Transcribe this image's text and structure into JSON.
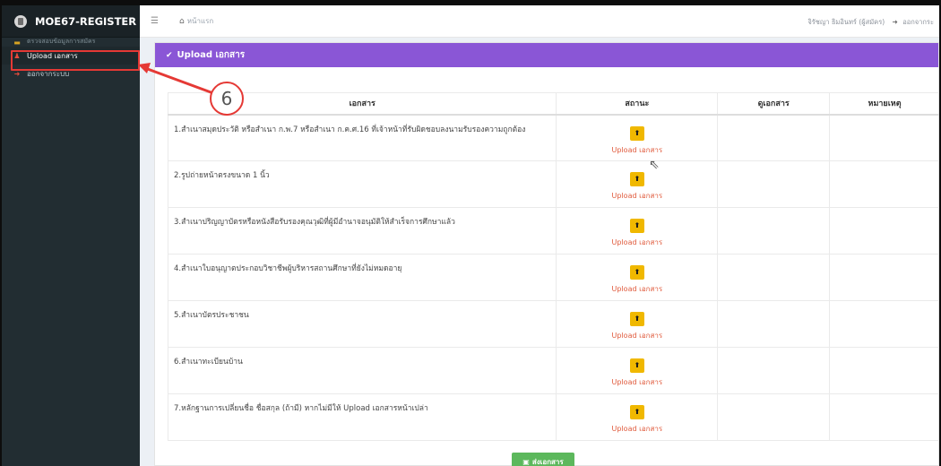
{
  "app": {
    "title": "MOE67-REGISTER"
  },
  "sidebar": {
    "partial_item": "ตรวจสอบข้อมูลการสมัคร",
    "items": [
      {
        "label": "Upload เอกสาร",
        "icon": "upload-user-icon"
      },
      {
        "label": "ออกจากระบบ",
        "icon": "logout-icon"
      }
    ]
  },
  "header": {
    "breadcrumb": "หน้าแรก",
    "user": "จิรัชญา ธิมอินทร์ (ผู้สมัคร)",
    "logout": "ออกจากระ"
  },
  "panel": {
    "title": "Upload เอกสาร"
  },
  "table": {
    "headers": [
      "เอกสาร",
      "สถานะ",
      "ดูเอกสาร",
      "หมายเหตุ"
    ],
    "rows": [
      {
        "doc": "1.สำเนาสมุดประวัติ หรือสำเนา ก.พ.7 หรือสำเนา ก.ค.ศ.16 ที่เจ้าหน้าที่รับผิดชอบลงนามรับรองความถูกต้อง",
        "status": "Upload เอกสาร"
      },
      {
        "doc": "2.รูปถ่ายหน้าตรงขนาด 1 นิ้ว",
        "status": "Upload เอกสาร"
      },
      {
        "doc": "3.สำเนาปริญญาบัตรหรือหนังสือรับรองคุณวุฒิที่ผู้มีอำนาจอนุมัติให้สำเร็จการศึกษาแล้ว",
        "status": "Upload เอกสาร"
      },
      {
        "doc": "4.สำเนาใบอนุญาตประกอบวิชาชีพผู้บริหารสถานศึกษาที่ยังไม่หมดอายุ",
        "status": "Upload เอกสาร"
      },
      {
        "doc": "5.สำเนาบัตรประชาชน",
        "status": "Upload เอกสาร"
      },
      {
        "doc": "6.สำเนาทะเบียนบ้าน",
        "status": "Upload เอกสาร"
      },
      {
        "doc": "7.หลักฐานการเปลี่ยนชื่อ ชื่อสกุล (ถ้ามี) หากไม่มีให้ Upload เอกสารหน้าเปล่า",
        "status": "Upload เอกสาร"
      }
    ]
  },
  "submit": {
    "label": "ส่งเอกสาร"
  },
  "annotation": {
    "step": "6"
  },
  "colors": {
    "sidebar_bg": "#222d32",
    "panel_header": "#8a56d6",
    "upload_button": "#f0b800",
    "upload_link": "#e05a3c",
    "submit_button": "#5cb85c",
    "annotation": "#e53935"
  }
}
